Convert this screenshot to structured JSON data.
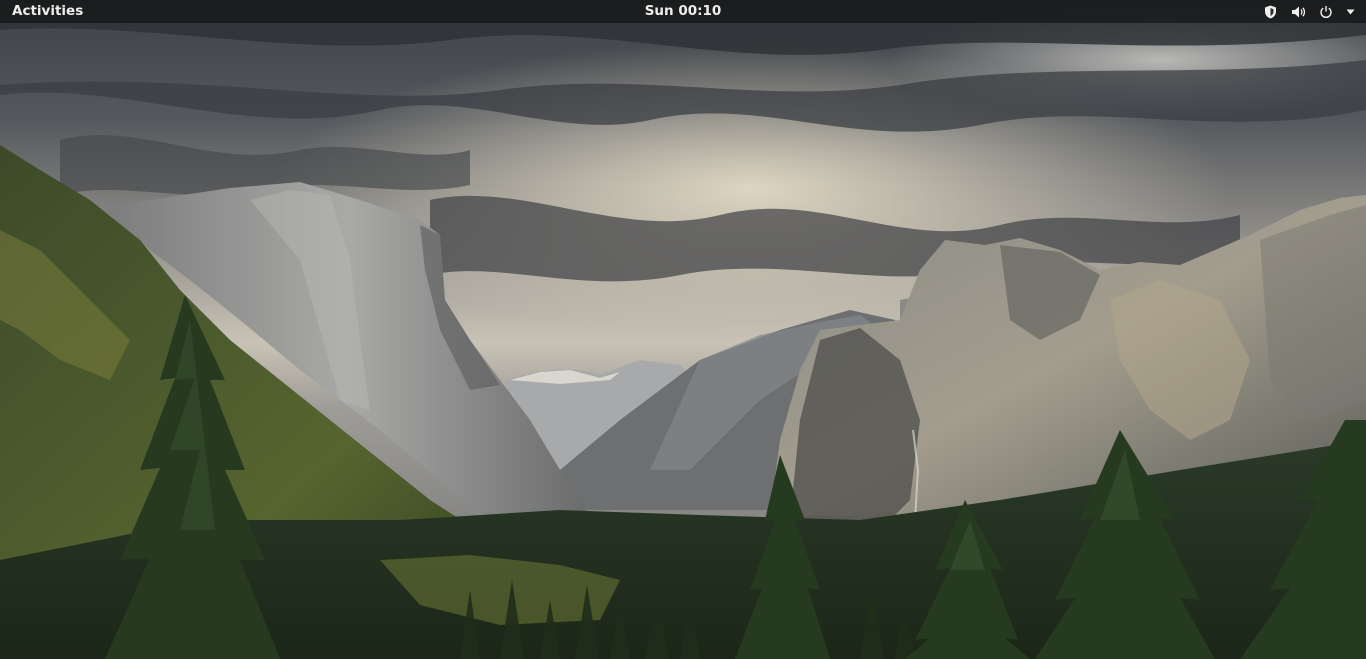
{
  "topbar": {
    "activities_label": "Activities",
    "clock": "Sun 00:10",
    "system_icons": [
      "shield-icon",
      "volume-icon",
      "power-icon",
      "dropdown-arrow-icon"
    ],
    "icon_color": "#eeeeec"
  },
  "wallpaper": {
    "description_icon": "landscape-wallpaper"
  }
}
